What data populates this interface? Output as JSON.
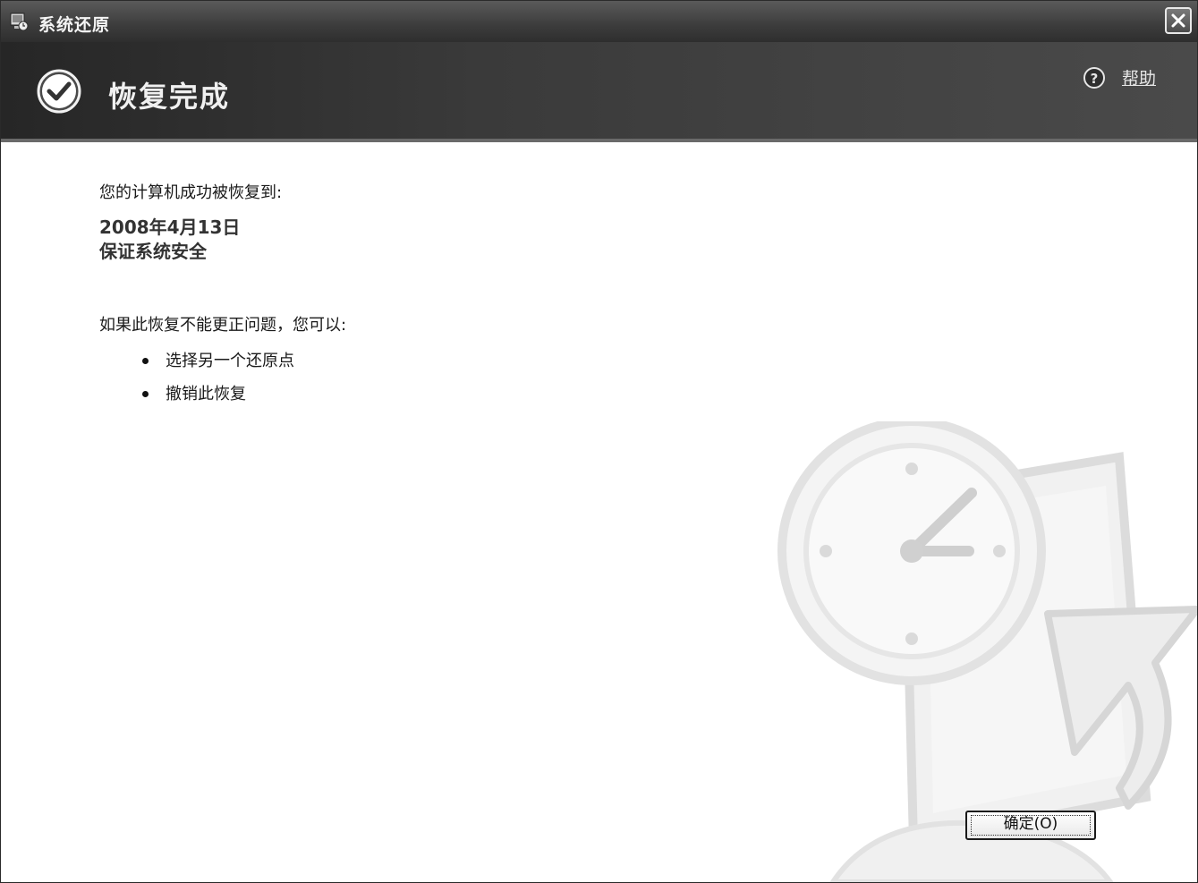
{
  "window": {
    "title": "系统还原"
  },
  "header": {
    "title": "恢复完成",
    "help_label": "帮助"
  },
  "content": {
    "intro": "您的计算机成功被恢复到:",
    "restore_date": "2008年4月13日",
    "restore_description": "保证系统安全",
    "problem_text": "如果此恢复不能更正问题，您可以:",
    "options": [
      {
        "label": "选择另一个还原点"
      },
      {
        "label": "撤销此恢复"
      }
    ]
  },
  "buttons": {
    "ok_label": "确定(O)"
  },
  "icons": {
    "title": "system-restore-icon",
    "header": "checkmark-icon",
    "help": "help-icon",
    "close": "close-icon",
    "watermark": "clock-restore-icon"
  }
}
